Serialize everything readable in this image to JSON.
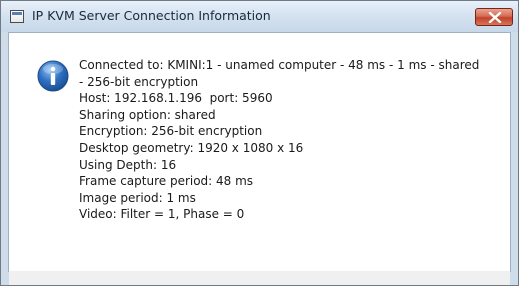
{
  "window": {
    "title": "IP KVM Server Connection Information",
    "icon": "application-icon",
    "close_icon": "close-icon"
  },
  "dialog": {
    "icon": "information-icon",
    "lines": [
      "Connected to: KMINI:1 - unamed computer - 48 ms - 1 ms - shared",
      "- 256-bit encryption",
      "Host: 192.168.1.196  port: 5960",
      "Sharing option: shared",
      "Encryption: 256-bit encryption",
      "Desktop geometry: 1920 x 1080 x 16",
      "Using Depth: 16",
      "Frame capture period: 48 ms",
      "Image period: 1 ms",
      "Video: Filter = 1, Phase = 0"
    ]
  },
  "colors": {
    "titlebar": "#d5e3f1",
    "close_button": "#c2412a",
    "info_icon": "#2f6fc1"
  }
}
